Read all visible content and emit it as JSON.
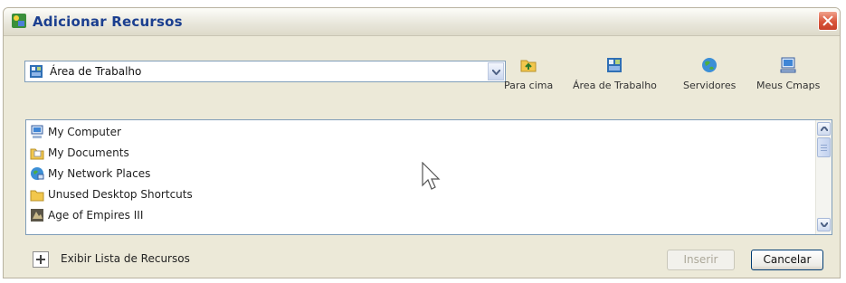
{
  "window": {
    "title": "Adicionar Recursos"
  },
  "location": {
    "value": "Área de Trabalho"
  },
  "toolbar": {
    "up_label": "Para cima",
    "desktop_label": "Área de Trabalho",
    "servers_label": "Servidores",
    "mycmaps_label": "Meus Cmaps"
  },
  "list": {
    "items": [
      {
        "label": "My Computer",
        "icon": "computer-icon"
      },
      {
        "label": "My Documents",
        "icon": "documents-folder-icon"
      },
      {
        "label": "My Network Places",
        "icon": "network-places-icon"
      },
      {
        "label": "Unused Desktop Shortcuts",
        "icon": "folder-icon"
      },
      {
        "label": "Age of Empires III",
        "icon": "game-shortcut-icon"
      }
    ]
  },
  "footer": {
    "expand_label": "Exibir Lista de Recursos",
    "insert_label": "Inserir",
    "cancel_label": "Cancelar"
  }
}
